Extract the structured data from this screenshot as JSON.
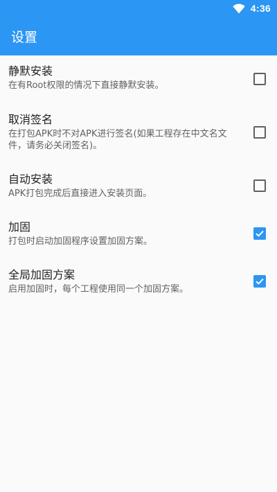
{
  "status_bar": {
    "time": "4:36",
    "wifi_icon": "wifi-icon"
  },
  "app_bar": {
    "title": "设置"
  },
  "colors": {
    "primary": "#2b96f3",
    "background": "#fafafa",
    "checkbox_unchecked": "#5f5f5f"
  },
  "settings": [
    {
      "title": "静默安装",
      "summary": "在有Root权限的情况下直接静默安装。",
      "checked": false
    },
    {
      "title": "取消签名",
      "summary": "在打包APK时不对APK进行签名(如果工程存在中文名文件，请务必关闭签名)。",
      "checked": false
    },
    {
      "title": "自动安装",
      "summary": "APK打包完成后直接进入安装页面。",
      "checked": false
    },
    {
      "title": "加固",
      "summary": "打包时启动加固程序设置加固方案。",
      "checked": true
    },
    {
      "title": "全局加固方案",
      "summary": "启用加固时，每个工程使用同一个加固方案。",
      "checked": true
    }
  ]
}
